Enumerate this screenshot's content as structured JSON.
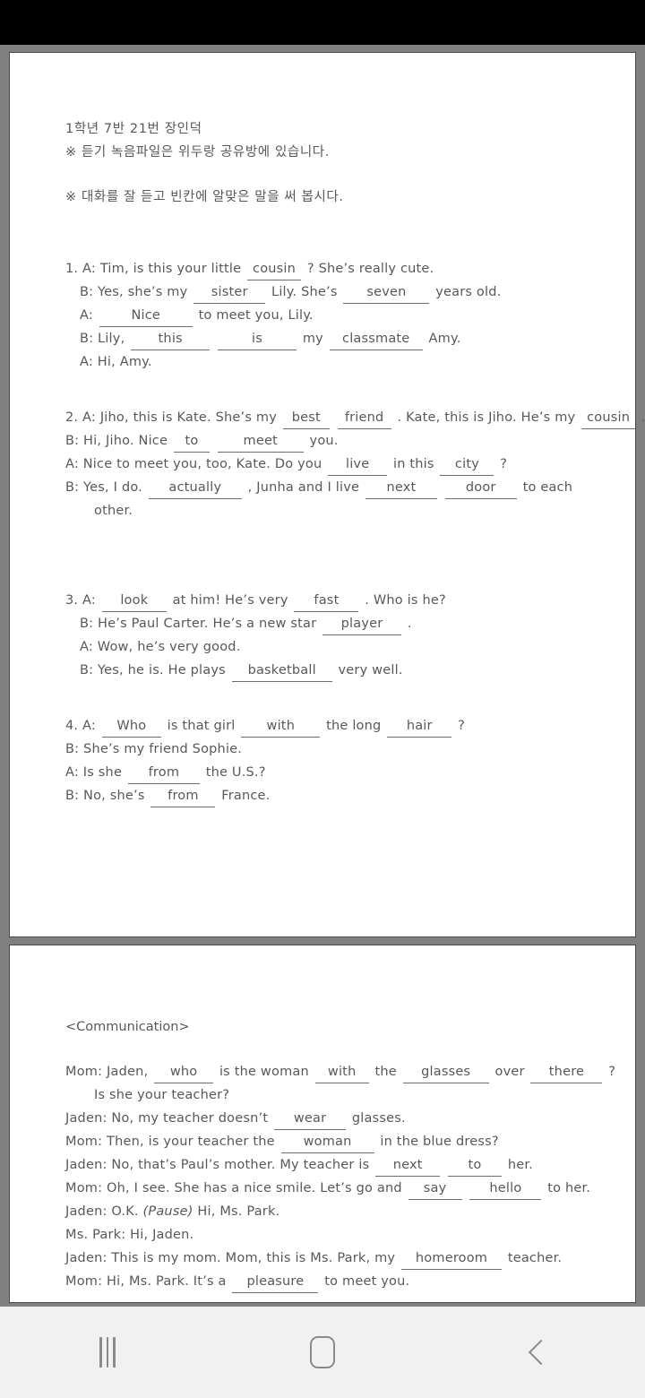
{
  "device": {
    "status_bar": "",
    "nav": {
      "recents_label": "Recent apps",
      "home_label": "Home",
      "back_label": "Back"
    }
  },
  "document": {
    "page1": {
      "header": {
        "student_line": "1학년 7반 21번 장인덕",
        "note_line": "※ 듣기 녹음파일은 위두랑 공유방에 있습니다.",
        "instruction_line": "※ 대화를 잘 듣고 빈칸에 알맞은 말을 써 봅시다."
      },
      "items": [
        {
          "number": "1.",
          "lines": [
            {
              "indent": 1,
              "speaker": "A:",
              "parts": [
                {
                  "t": "text",
                  "v": "Tim, is this your little"
                },
                {
                  "t": "blank",
                  "v": "cousin",
                  "w": "w60"
                },
                {
                  "t": "text",
                  "v": "? She’s really cute."
                }
              ]
            },
            {
              "indent": 2,
              "speaker": "B:",
              "parts": [
                {
                  "t": "text",
                  "v": "Yes, she’s my"
                },
                {
                  "t": "blank",
                  "v": "sister",
                  "w": "w80"
                },
                {
                  "t": "text",
                  "v": "Lily. She’s"
                },
                {
                  "t": "blank",
                  "v": "seven",
                  "w": "w96"
                },
                {
                  "t": "text",
                  "v": "years old."
                }
              ]
            },
            {
              "indent": 2,
              "speaker": "A:",
              "parts": [
                {
                  "t": "blank",
                  "v": "Nice",
                  "w": "w104"
                },
                {
                  "t": "text",
                  "v": "to meet you, Lily."
                }
              ]
            },
            {
              "indent": 2,
              "speaker": "B:",
              "parts": [
                {
                  "t": "text",
                  "v": "Lily,"
                },
                {
                  "t": "blank",
                  "v": "this",
                  "w": "w88"
                },
                {
                  "t": "blank",
                  "v": "is",
                  "w": "w88"
                },
                {
                  "t": "text",
                  "v": "my"
                },
                {
                  "t": "blank",
                  "v": "classmate",
                  "w": "w104"
                },
                {
                  "t": "text",
                  "v": "Amy."
                }
              ]
            },
            {
              "indent": 2,
              "speaker": "A:",
              "parts": [
                {
                  "t": "text",
                  "v": "Hi, Amy."
                }
              ]
            }
          ]
        },
        {
          "number": "2.",
          "lines": [
            {
              "indent": 1,
              "speaker": "A:",
              "parts": [
                {
                  "t": "text",
                  "v": "Jiho, this is Kate. She’s my"
                },
                {
                  "t": "blank",
                  "v": "best",
                  "w": "w52"
                },
                {
                  "t": "blank",
                  "v": "friend",
                  "w": "w60"
                },
                {
                  "t": "text",
                  "v": ". Kate, this is Jiho. He’s my"
                },
                {
                  "t": "blank",
                  "v": "cousin",
                  "w": "w60"
                },
                {
                  "t": "text",
                  "v": "."
                }
              ]
            },
            {
              "indent": 0,
              "speaker": "B:",
              "parts": [
                {
                  "t": "text",
                  "v": "Hi, Jiho. Nice"
                },
                {
                  "t": "blank",
                  "v": "to",
                  "w": "w40"
                },
                {
                  "t": "blank",
                  "v": "meet",
                  "w": "w96"
                },
                {
                  "t": "text",
                  "v": "you."
                }
              ]
            },
            {
              "indent": 0,
              "speaker": "A:",
              "parts": [
                {
                  "t": "text",
                  "v": "Nice to meet you, too, Kate. Do you"
                },
                {
                  "t": "blank",
                  "v": "live",
                  "w": "w66"
                },
                {
                  "t": "text",
                  "v": "in this"
                },
                {
                  "t": "blank",
                  "v": "city",
                  "w": "w60"
                },
                {
                  "t": "text",
                  "v": "?"
                }
              ]
            },
            {
              "indent": 0,
              "speaker": "B:",
              "parts": [
                {
                  "t": "text",
                  "v": "Yes, I do."
                },
                {
                  "t": "blank",
                  "v": "actually",
                  "w": "w104"
                },
                {
                  "t": "text",
                  "v": ", Junha and I live"
                },
                {
                  "t": "blank",
                  "v": "next",
                  "w": "w80"
                },
                {
                  "t": "blank",
                  "v": "door",
                  "w": "w80"
                },
                {
                  "t": "text",
                  "v": "to each"
                }
              ]
            },
            {
              "indent": 3,
              "speaker": "",
              "parts": [
                {
                  "t": "text",
                  "v": "other."
                }
              ]
            }
          ]
        },
        {
          "number": "3.",
          "lines": [
            {
              "indent": 1,
              "speaker": "A:",
              "parts": [
                {
                  "t": "blank",
                  "v": "look",
                  "w": "w72"
                },
                {
                  "t": "text",
                  "v": "at him! He’s very"
                },
                {
                  "t": "blank",
                  "v": "fast",
                  "w": "w72"
                },
                {
                  "t": "text",
                  "v": ". Who is he?"
                }
              ]
            },
            {
              "indent": 2,
              "speaker": "B:",
              "parts": [
                {
                  "t": "text",
                  "v": "He’s Paul Carter. He’s a new star"
                },
                {
                  "t": "blank",
                  "v": "player",
                  "w": "w88"
                },
                {
                  "t": "text",
                  "v": "."
                }
              ]
            },
            {
              "indent": 2,
              "speaker": "A:",
              "parts": [
                {
                  "t": "text",
                  "v": "Wow, he’s very good."
                }
              ]
            },
            {
              "indent": 2,
              "speaker": "B:",
              "parts": [
                {
                  "t": "text",
                  "v": "Yes, he is. He plays"
                },
                {
                  "t": "blank",
                  "v": "basketball",
                  "w": "w112"
                },
                {
                  "t": "text",
                  "v": "very well."
                }
              ]
            }
          ]
        },
        {
          "number": "4.",
          "lines": [
            {
              "indent": 1,
              "speaker": "A:",
              "parts": [
                {
                  "t": "blank",
                  "v": "Who",
                  "w": "w66"
                },
                {
                  "t": "text",
                  "v": "is that girl"
                },
                {
                  "t": "blank",
                  "v": "with",
                  "w": "w88"
                },
                {
                  "t": "text",
                  "v": "the long"
                },
                {
                  "t": "blank",
                  "v": "hair",
                  "w": "w72"
                },
                {
                  "t": "text",
                  "v": "?"
                }
              ]
            },
            {
              "indent": 0,
              "speaker": "B:",
              "parts": [
                {
                  "t": "text",
                  "v": "She’s my friend Sophie."
                }
              ]
            },
            {
              "indent": 0,
              "speaker": "A:",
              "parts": [
                {
                  "t": "text",
                  "v": "Is she"
                },
                {
                  "t": "blank",
                  "v": "from",
                  "w": "w80"
                },
                {
                  "t": "text",
                  "v": "the U.S.?"
                }
              ]
            },
            {
              "indent": 0,
              "speaker": "B:",
              "parts": [
                {
                  "t": "text",
                  "v": "No, she’s"
                },
                {
                  "t": "blank",
                  "v": "from",
                  "w": "w72"
                },
                {
                  "t": "text",
                  "v": "France."
                }
              ]
            }
          ]
        }
      ]
    },
    "page2": {
      "title": "<Communication>",
      "lines": [
        {
          "indent": 0,
          "speaker": "Mom:",
          "parts": [
            {
              "t": "text",
              "v": "Jaden,"
            },
            {
              "t": "blank",
              "v": "who",
              "w": "w66"
            },
            {
              "t": "text",
              "v": "is the woman"
            },
            {
              "t": "blank",
              "v": "with",
              "w": "w60"
            },
            {
              "t": "text",
              "v": "the"
            },
            {
              "t": "blank",
              "v": "glasses",
              "w": "w96"
            },
            {
              "t": "text",
              "v": "over"
            },
            {
              "t": "blank",
              "v": "there",
              "w": "w80"
            },
            {
              "t": "text",
              "v": "?"
            }
          ]
        },
        {
          "indent": 3,
          "speaker": "",
          "parts": [
            {
              "t": "text",
              "v": "Is she your teacher?"
            }
          ]
        },
        {
          "indent": 0,
          "speaker": "Jaden:",
          "parts": [
            {
              "t": "text",
              "v": "No, my teacher doesn’t"
            },
            {
              "t": "blank",
              "v": "wear",
              "w": "w80"
            },
            {
              "t": "text",
              "v": "glasses."
            }
          ]
        },
        {
          "indent": 0,
          "speaker": "Mom:",
          "parts": [
            {
              "t": "text",
              "v": "Then, is your teacher the"
            },
            {
              "t": "blank",
              "v": "woman",
              "w": "w104"
            },
            {
              "t": "text",
              "v": "in the blue dress?"
            }
          ]
        },
        {
          "indent": 0,
          "speaker": "Jaden:",
          "parts": [
            {
              "t": "text",
              "v": "No, that’s Paul’s mother. My teacher is"
            },
            {
              "t": "blank",
              "v": "next",
              "w": "w72"
            },
            {
              "t": "blank",
              "v": "to",
              "w": "w60"
            },
            {
              "t": "text",
              "v": "her."
            }
          ]
        },
        {
          "indent": 0,
          "speaker": "Mom:",
          "parts": [
            {
              "t": "text",
              "v": "Oh, I see. She has a nice smile. Let’s go and"
            },
            {
              "t": "blank",
              "v": "say",
              "w": "w60"
            },
            {
              "t": "blank",
              "v": "hello",
              "w": "w80"
            },
            {
              "t": "text",
              "v": "to her."
            }
          ]
        },
        {
          "indent": 0,
          "speaker": "Jaden:",
          "parts": [
            {
              "t": "text",
              "v": "O.K."
            },
            {
              "t": "italic",
              "v": "(Pause)"
            },
            {
              "t": "text",
              "v": "Hi, Ms. Park."
            }
          ]
        },
        {
          "indent": 0,
          "speaker": "Ms. Park:",
          "parts": [
            {
              "t": "text",
              "v": "Hi, Jaden."
            }
          ]
        },
        {
          "indent": 0,
          "speaker": "Jaden:",
          "parts": [
            {
              "t": "text",
              "v": "This is my mom. Mom, this is Ms. Park, my"
            },
            {
              "t": "blank",
              "v": "homeroom",
              "w": "w112"
            },
            {
              "t": "text",
              "v": "teacher."
            }
          ]
        },
        {
          "indent": 0,
          "speaker": "Mom:",
          "parts": [
            {
              "t": "text",
              "v": "Hi, Ms. Park. It’s a"
            },
            {
              "t": "blank",
              "v": "pleasure",
              "w": "w96"
            },
            {
              "t": "text",
              "v": "to meet you."
            }
          ]
        }
      ]
    }
  },
  "colors": {
    "background": "#808080",
    "page": "#ffffff",
    "text": "#58585a",
    "nav_bar": "#f1f1f1",
    "nav_icon": "#8a8a8a",
    "status_bar": "#000000"
  }
}
